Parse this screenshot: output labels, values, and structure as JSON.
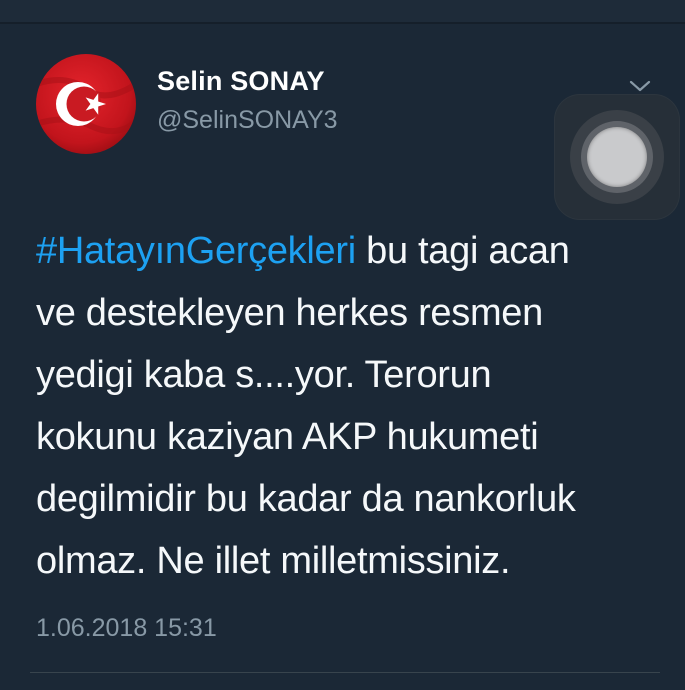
{
  "user": {
    "display_name": "Selin SONAY",
    "handle": "@SelinSONAY3",
    "avatar_icon": "turkish-flag-icon"
  },
  "tweet": {
    "hashtag": "#HatayınGerçekleri",
    "text_lines": [
      " bu tagi acan",
      "ve destekleyen herkes resmen",
      "yedigi kaba s....yor. Terorun",
      "kokunu kaziyan AKP hukumeti",
      "degilmidir bu kadar da nankorluk",
      "olmaz. Ne illet milletmissiniz."
    ],
    "timestamp": "1.06.2018 15:31"
  },
  "colors": {
    "background": "#1b2836",
    "hashtag": "#1da1f2",
    "secondary_text": "#8899a6",
    "primary_text": "#f5f8fa"
  },
  "icons": {
    "menu": "chevron-down-icon",
    "assistive_touch": "assistive-touch-icon"
  }
}
